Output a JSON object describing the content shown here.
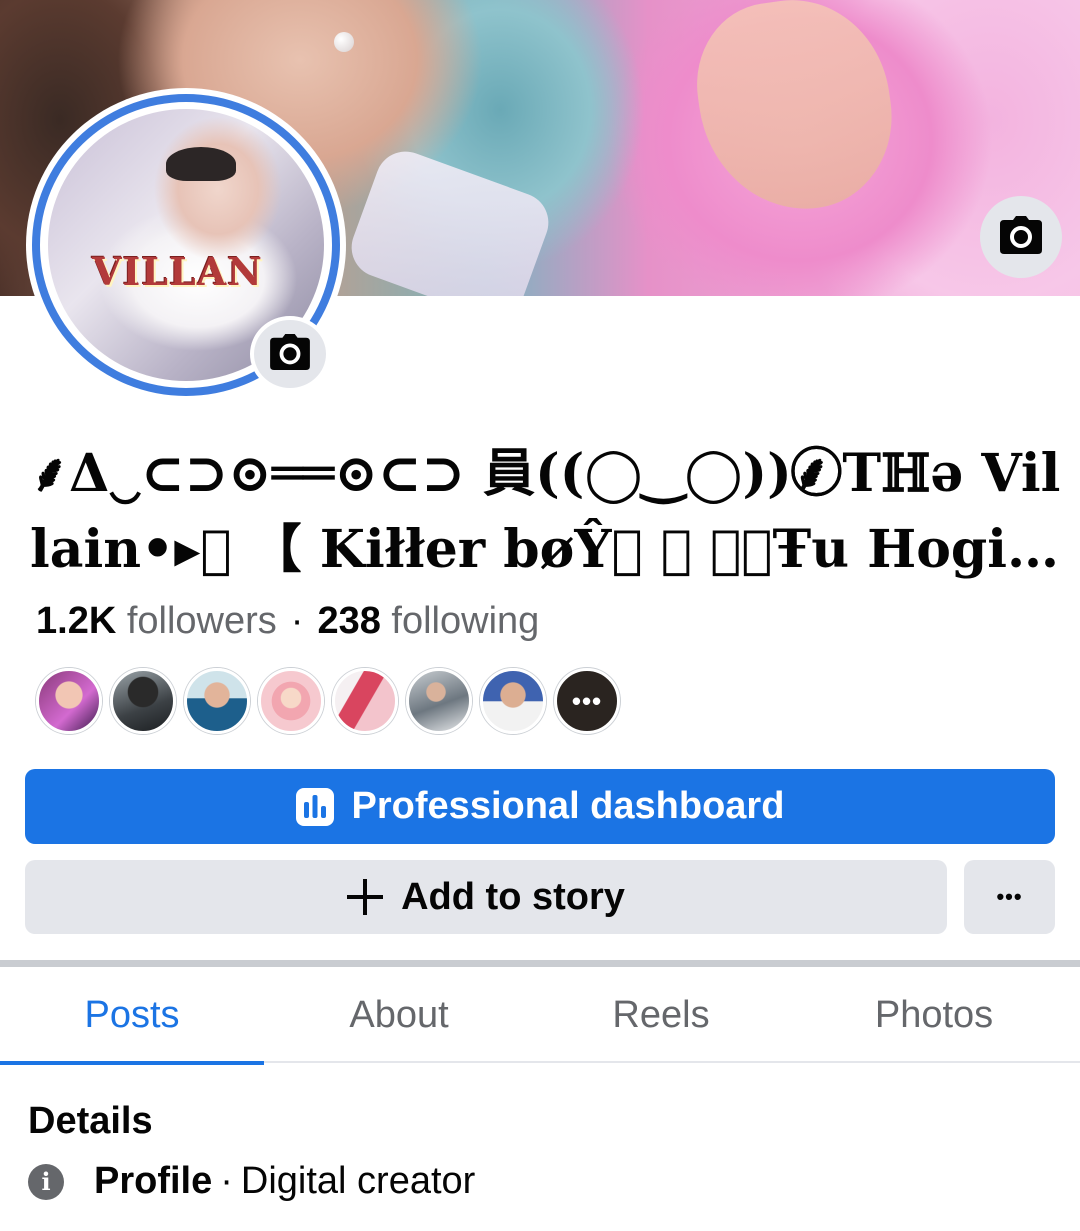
{
  "profile": {
    "name": "⸙Δ‿⊂⊃⊙══⊙⊂⊃ 員((◯‿◯))⸙ ⃝⃝Tℍə Villain•▸⃝ 【 Kiłłer bøŶ⃝ ⃝ ⃝⃝Ŧu Hogi …",
    "followers_count": "1.2K",
    "followers_label": "followers",
    "following_count": "238",
    "following_label": "following",
    "avatar_logo_text": "VILLAN"
  },
  "friends_more_label": "•••",
  "buttons": {
    "professional_dashboard": "Professional dashboard",
    "add_to_story": "Add to story",
    "more": "•••"
  },
  "tabs": [
    "Posts",
    "About",
    "Reels",
    "Photos"
  ],
  "active_tab": "Posts",
  "details": {
    "title": "Details",
    "profile_label": "Profile",
    "profile_value": "Digital creator"
  },
  "icons": {
    "cover_camera": "camera-icon",
    "avatar_camera": "camera-icon",
    "dashboard": "bar-chart-icon",
    "add": "plus-icon",
    "info": "info-icon"
  },
  "colors": {
    "accent": "#1b74e4",
    "avatar_ring": "#3f7ddf",
    "secondary_button": "#e4e6eb",
    "muted_text": "#65676b"
  }
}
